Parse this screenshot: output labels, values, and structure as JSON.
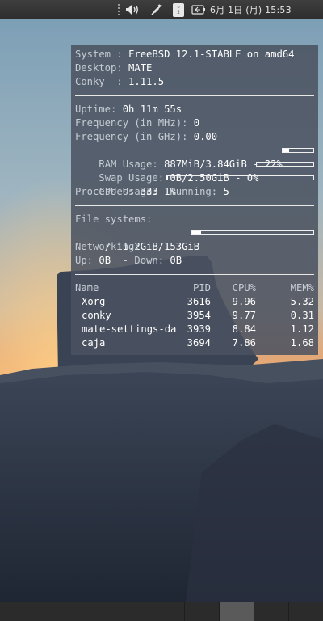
{
  "top_panel": {
    "workspace_label": "2",
    "clock": "6月 1日 (月) 15:53"
  },
  "conky": {
    "system_label": "System : ",
    "system_value": "FreeBSD 12.1-STABLE on amd64",
    "desktop_label": "Desktop: ",
    "desktop_value": "MATE",
    "conky_label": "Conky  : ",
    "conky_value": "1.11.5",
    "uptime_label": "Uptime: ",
    "uptime_value": "0h 11m 55s",
    "freq_mhz_label": "Frequency (in MHz): ",
    "freq_mhz_value": "0",
    "freq_ghz_label": "Frequency (in GHz): ",
    "freq_ghz_value": "0.00",
    "ram_label": "RAM Usage: ",
    "ram_value": "887MiB/3.84GiB - 22%",
    "ram_percent": 22,
    "swap_label": "Swap Usage: ",
    "swap_value": "0B/2.50GiB - 0%",
    "swap_percent": 0,
    "cpu_label": "CPU Usage: ",
    "cpu_value": "1%",
    "cpu_percent": 1,
    "processes_label": "Processes: ",
    "processes_value": "333",
    "running_label": "  Running: ",
    "running_value": "5",
    "fs_label": "File systems:",
    "fs_root_label": " / ",
    "fs_root_value": "11.2GiB/153GiB",
    "fs_root_percent": 7,
    "net_label": "Networking:",
    "up_label": "Up: ",
    "up_value": "0B",
    "down_label": "  - Down: ",
    "down_value": "0B",
    "table_headers": {
      "name": "Name",
      "pid": "PID",
      "cpu": "CPU%",
      "mem": "MEM%"
    },
    "processes": [
      {
        "name": "Xorg",
        "pid": "3616",
        "cpu": "9.96",
        "mem": "5.32"
      },
      {
        "name": "conky",
        "pid": "3954",
        "cpu": "9.77",
        "mem": "0.31"
      },
      {
        "name": "mate-settings-da",
        "pid": "3939",
        "cpu": "8.84",
        "mem": "1.12"
      },
      {
        "name": "caja",
        "pid": "3694",
        "cpu": "7.86",
        "mem": "1.68"
      }
    ]
  },
  "bottom_panel": {
    "active_workspace": 2,
    "workspace_count": 4
  }
}
